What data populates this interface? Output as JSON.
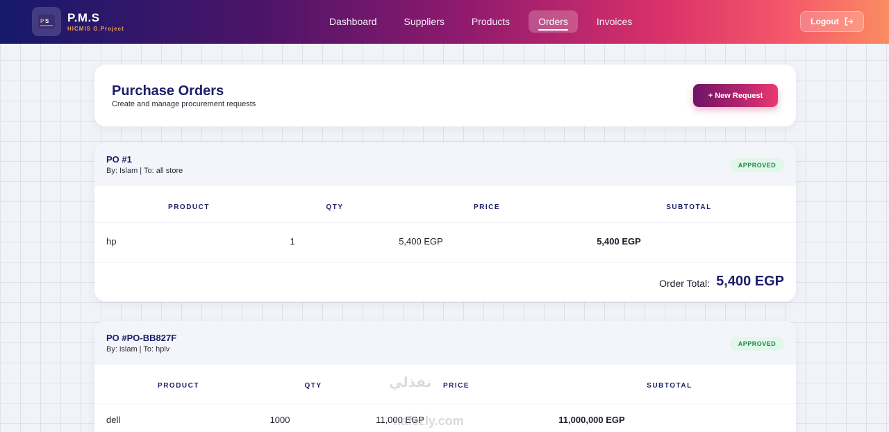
{
  "brand": {
    "title": "P.M.S",
    "subtitle": "HICMIS G.Project"
  },
  "nav": {
    "items": [
      {
        "label": "Dashboard",
        "active": false
      },
      {
        "label": "Suppliers",
        "active": false
      },
      {
        "label": "Products",
        "active": false
      },
      {
        "label": "Orders",
        "active": true
      },
      {
        "label": "Invoices",
        "active": false
      }
    ],
    "logout_label": "Logout",
    "logout_icon": "logout-icon"
  },
  "page": {
    "title": "Purchase Orders",
    "subtitle": "Create and manage procurement requests",
    "new_button_label": "+ New Request"
  },
  "table_headers": {
    "product": "PRODUCT",
    "qty": "QTY",
    "price": "PRICE",
    "subtotal": "SUBTOTAL"
  },
  "orders": [
    {
      "title": "PO #1",
      "meta": "By: Islam | To: all store",
      "status": "APPROVED",
      "items": [
        {
          "product": "hp",
          "qty": "1",
          "price": "5,400 EGP",
          "subtotal": "5,400 EGP"
        }
      ],
      "total_label": "Order Total:",
      "total_value": "5,400 EGP"
    },
    {
      "title": "PO #PO-BB827F",
      "meta": "By: islam | To: hplv",
      "status": "APPROVED",
      "items": [
        {
          "product": "dell",
          "qty": "1000",
          "price": "11,000 EGP",
          "subtotal": "11,000,000 EGP"
        }
      ]
    }
  ],
  "colors": {
    "accent": "#1b1f66",
    "status_approved": "#178a47",
    "status_approved_bg": "#e2f6e9"
  },
  "watermark": {
    "arabic": "نفذلي",
    "latin": "nafezly.com"
  }
}
